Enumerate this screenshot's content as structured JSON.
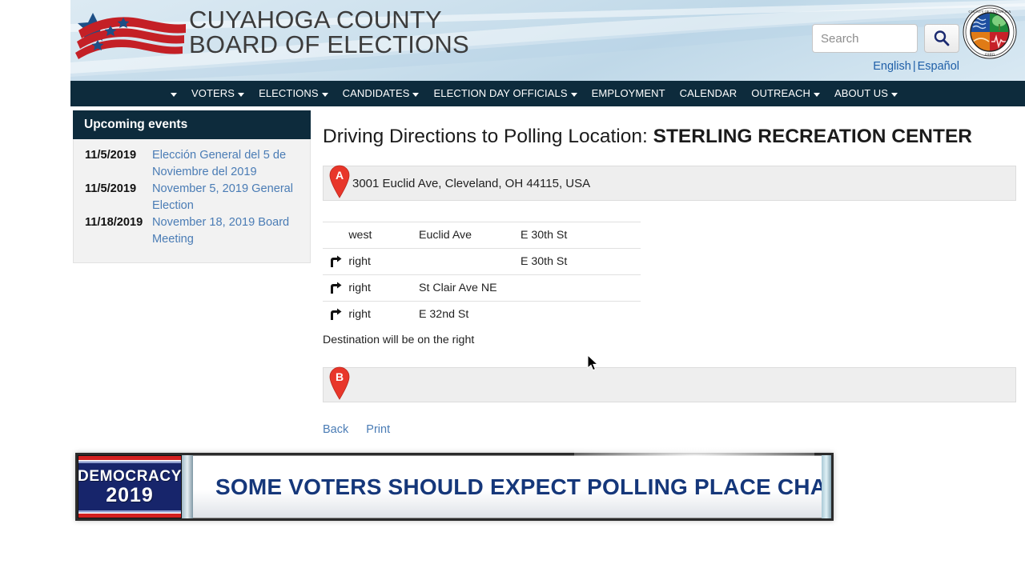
{
  "header": {
    "logo_line1": "CUYAHOGA COUNTY",
    "logo_line2": "BOARD OF ELECTIONS",
    "search_placeholder": "Search",
    "search_value": "",
    "search_icon": "search-icon",
    "lang_english": "English",
    "lang_separator": "|",
    "lang_espanol": "Español",
    "seal_alt": "county-seal",
    "accent_navy": "#0d2b3c",
    "link_blue": "#4a7cb5"
  },
  "nav": {
    "items": [
      {
        "label": "",
        "caret": true
      },
      {
        "label": "VOTERS",
        "caret": true
      },
      {
        "label": "ELECTIONS",
        "caret": true
      },
      {
        "label": "CANDIDATES",
        "caret": true
      },
      {
        "label": "ELECTION DAY OFFICIALS",
        "caret": true
      },
      {
        "label": "EMPLOYMENT",
        "caret": false
      },
      {
        "label": "CALENDAR",
        "caret": false
      },
      {
        "label": "OUTREACH",
        "caret": true
      },
      {
        "label": "ABOUT US",
        "caret": true
      }
    ]
  },
  "sidebar": {
    "title": "Upcoming events",
    "events": [
      {
        "date": "11/5/2019",
        "label": "Elección General del 5 de Noviembre del 2019"
      },
      {
        "date": "11/5/2019",
        "label": "November 5, 2019 General Election"
      },
      {
        "date": "11/18/2019",
        "label": "November 18, 2019 Board Meeting"
      }
    ]
  },
  "main": {
    "title_prefix": "Driving Directions to Polling Location: ",
    "title_location": "STERLING RECREATION CENTER",
    "origin": {
      "marker": "A",
      "address": "3001 Euclid Ave, Cleveland, OH 44115, USA"
    },
    "destination": {
      "marker": "B",
      "address": ""
    },
    "directions": [
      {
        "icon": "",
        "direction": "west",
        "street": "Euclid Ave",
        "toward": "E 30th St"
      },
      {
        "icon": "turn-right-icon",
        "direction": "right",
        "street": "",
        "toward": "E 30th St"
      },
      {
        "icon": "turn-right-icon",
        "direction": "right",
        "street": "St Clair Ave NE",
        "toward": ""
      },
      {
        "icon": "turn-right-icon",
        "direction": "right",
        "street": "E 32nd St",
        "toward": ""
      }
    ],
    "destination_note": "Destination will be on the right",
    "back_label": "Back",
    "print_label": "Print"
  },
  "banner": {
    "badge_line1": "DEMOCRACY",
    "badge_line2": "2019",
    "headline": "SOME VOTERS SHOULD EXPECT POLLING PLACE CHANGES",
    "badge_navy": "#17256b",
    "headline_blue": "#15377a"
  }
}
